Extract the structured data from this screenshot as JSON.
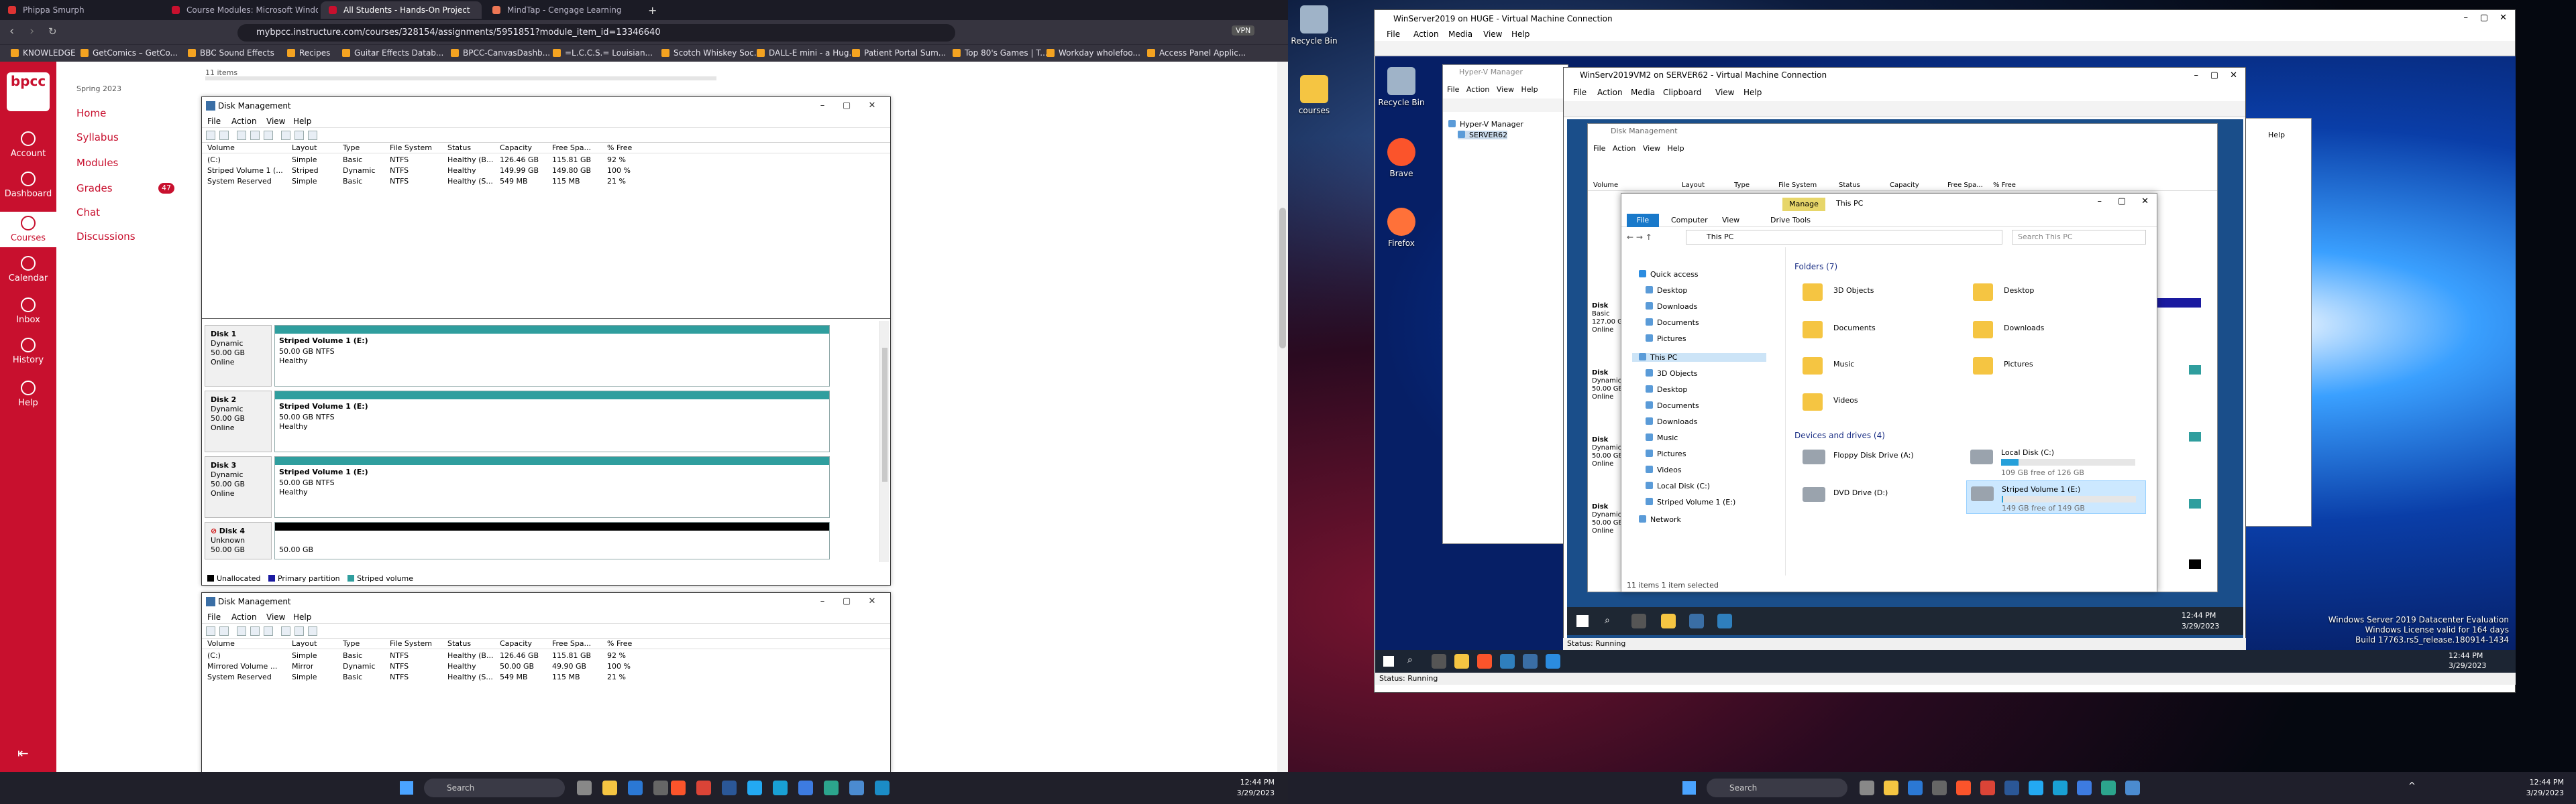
{
  "browser": {
    "tabs": [
      {
        "label": "Phippa Smurph"
      },
      {
        "label": "Course Modules: Microsoft Windo..."
      },
      {
        "label": "All Students - Hands-On Project"
      },
      {
        "label": "MindTap - Cengage Learning"
      }
    ],
    "url": "mybpcc.instructure.com/courses/328154/assignments/5951851?module_item_id=13346640",
    "bookmarks": [
      "KNOWLEDGE",
      "GetComics – GetCo...",
      "BBC Sound Effects",
      "Recipes",
      "Guitar Effects Datab...",
      "BPCC-CanvasDashb...",
      "=L.C.C.S.= Louisian...",
      "Scotch Whiskey Soc...",
      "DALL-E mini - a Hug...",
      "Patient Portal Sum...",
      "Top 80's Games | T...",
      "Workday wholefoo...",
      "Access Panel Applic..."
    ]
  },
  "canvas": {
    "logo": "bpcc",
    "nav": [
      "Account",
      "Dashboard",
      "Courses",
      "Calendar",
      "Inbox",
      "History",
      "Help"
    ],
    "semester": "Spring 2023",
    "course_nav": [
      "Home",
      "Syllabus",
      "Modules",
      "Grades",
      "Chat",
      "Discussions"
    ],
    "grades_badge": "47",
    "items_count": "11 items"
  },
  "dm1": {
    "title": "Disk Management",
    "menu": [
      "File",
      "Action",
      "View",
      "Help"
    ],
    "columns": [
      "Volume",
      "Layout",
      "Type",
      "File System",
      "Status",
      "Capacity",
      "Free Spa...",
      "% Free"
    ],
    "rows": [
      [
        "(C:)",
        "Simple",
        "Basic",
        "NTFS",
        "Healthy (B...",
        "126.46 GB",
        "115.81 GB",
        "92 %"
      ],
      [
        "Striped Volume 1 (...",
        "Striped",
        "Dynamic",
        "NTFS",
        "Healthy",
        "149.99 GB",
        "149.80 GB",
        "100 %"
      ],
      [
        "System Reserved",
        "Simple",
        "Basic",
        "NTFS",
        "Healthy (S...",
        "549 MB",
        "115 MB",
        "21 %"
      ]
    ],
    "disks": [
      {
        "name": "Disk 1",
        "type": "Dynamic",
        "size": "50.00 GB",
        "state": "Online",
        "vol": "Striped Volume 1  (E:)",
        "detail": "50.00 GB NTFS",
        "health": "Healthy"
      },
      {
        "name": "Disk 2",
        "type": "Dynamic",
        "size": "50.00 GB",
        "state": "Online",
        "vol": "Striped Volume 1  (E:)",
        "detail": "50.00 GB NTFS",
        "health": "Healthy"
      },
      {
        "name": "Disk 3",
        "type": "Dynamic",
        "size": "50.00 GB",
        "state": "Online",
        "vol": "Striped Volume 1  (E:)",
        "detail": "50.00 GB NTFS",
        "health": "Healthy"
      },
      {
        "name": "Disk 4",
        "type": "Unknown",
        "size": "50.00 GB",
        "state": "",
        "vol": "",
        "detail": "50.00 GB",
        "health": ""
      }
    ],
    "legend": [
      "Unallocated",
      "Primary partition",
      "Striped volume"
    ]
  },
  "dm2": {
    "title": "Disk Management",
    "menu": [
      "File",
      "Action",
      "View",
      "Help"
    ],
    "columns": [
      "Volume",
      "Layout",
      "Type",
      "File System",
      "Status",
      "Capacity",
      "Free Spa...",
      "% Free"
    ],
    "rows": [
      [
        "(C:)",
        "Simple",
        "Basic",
        "NTFS",
        "Healthy (B...",
        "126.46 GB",
        "115.81 GB",
        "92 %"
      ],
      [
        "Mirrored Volume ...",
        "Mirror",
        "Dynamic",
        "NTFS",
        "Healthy",
        "50.00 GB",
        "49.90 GB",
        "100 %"
      ],
      [
        "System Reserved",
        "Simple",
        "Basic",
        "NTFS",
        "Healthy (S...",
        "549 MB",
        "115 MB",
        "21 %"
      ]
    ]
  },
  "taskbar_left": {
    "search": "Search",
    "time": "12:44 PM",
    "date": "3/29/2023"
  },
  "right": {
    "desktop_icons": [
      "Recycle Bin",
      "courses"
    ],
    "vmc1_title": "WinServer2019 on HUGE - Virtual Machine Connection",
    "vmc1_menu": [
      "File",
      "Action",
      "Media",
      "View",
      "Help"
    ],
    "guest1_icons": [
      "Recycle Bin",
      "Brave",
      "Firefox"
    ],
    "hvm_title": "Hyper-V Manager",
    "hvm_menu": [
      "File",
      "Action",
      "View",
      "Help"
    ],
    "hvm_tree": [
      "Hyper-V Manager",
      "SERVER62"
    ],
    "vmc2_title": "WinServ2019VM2 on SERVER62 - Virtual Machine Connection",
    "vmc2_menu": [
      "File",
      "Action",
      "Media",
      "Clipboard",
      "View",
      "Help"
    ],
    "inner_dm_title": "Disk Management",
    "inner_dm_menu": [
      "File",
      "Action",
      "View",
      "Help"
    ],
    "inner_dm_cols": [
      "Volume",
      "Layout",
      "Type",
      "File System",
      "Status",
      "Capacity",
      "Free Spa...",
      "% Free"
    ],
    "inner_disks": [
      {
        "name": "Disk",
        "type": "Basic",
        "size": "127.00 G",
        "state": "Online"
      },
      {
        "name": "Disk",
        "type": "Dynamic",
        "size": "50.00 GB",
        "state": "Online"
      },
      {
        "name": "Disk",
        "type": "Dynamic",
        "size": "50.00 GB",
        "state": "Online"
      },
      {
        "name": "Disk",
        "type": "Dynamic",
        "size": "50.00 GB",
        "state": "Online"
      }
    ],
    "explorer": {
      "title": "This PC",
      "manage_tab": "Manage",
      "ribbon_tabs": [
        "File",
        "Computer",
        "View",
        "Drive Tools"
      ],
      "address": "This PC",
      "search_placeholder": "Search This PC",
      "nav": [
        "Quick access",
        "Desktop",
        "Downloads",
        "Documents",
        "Pictures",
        "This PC",
        "3D Objects",
        "Desktop",
        "Documents",
        "Downloads",
        "Music",
        "Pictures",
        "Videos",
        "Local Disk (C:)",
        "Striped Volume 1 (E:)",
        "Network"
      ],
      "folders_header": "Folders (7)",
      "folders": [
        "3D Objects",
        "Desktop",
        "Documents",
        "Downloads",
        "Music",
        "Pictures",
        "Videos"
      ],
      "devices_header": "Devices and drives (4)",
      "drives": [
        {
          "name": "Floppy Disk Drive (A:)",
          "free": "",
          "used": 0
        },
        {
          "name": "Local Disk (C:)",
          "free": "109 GB free of 126 GB",
          "used": 0.13
        },
        {
          "name": "DVD Drive (D:)",
          "free": "",
          "used": 0
        },
        {
          "name": "Striped Volume 1 (E:)",
          "free": "149 GB free of 149 GB",
          "used": 0.01
        }
      ],
      "status": "11 items    1 item selected"
    },
    "guest2_time": "12:44 PM",
    "guest2_date": "3/29/2023",
    "g2status": "Status: Running",
    "g1status": "Status: Running",
    "help_btn": "Help",
    "wininfo": [
      "Windows Server 2019 Datacenter Evaluation",
      "Windows License valid for 164 days",
      "Build 17763.rs5_release.180914-1434"
    ],
    "guest1_time": "12:44 PM",
    "guest1_date": "3/29/2023",
    "host_search": "Search",
    "host_time": "12:44 PM",
    "host_date": "3/29/2023"
  },
  "colors": {
    "canvas_red": "#c8102e",
    "striped_teal": "#2f9e9e",
    "primary_blue": "#1a1aa0"
  }
}
